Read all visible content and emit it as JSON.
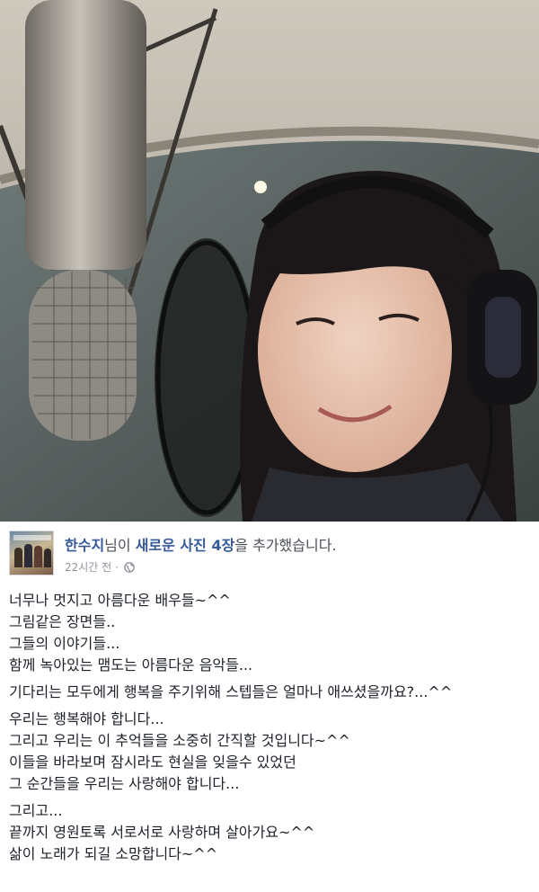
{
  "post": {
    "author_name": "한수지",
    "headline_mid": "님이 ",
    "headline_link": "새로운 사진 4장",
    "headline_end": "을 추가했습니다.",
    "timestamp": "22시간 전",
    "separator": " · ",
    "privacy_icon": "globe-icon",
    "paragraphs": [
      [
        "너무나 멋지고 아름다운 배우들~^^",
        "그림같은 장면들..",
        "그들의 이야기들...",
        "함께 녹아있는 맴도는 아름다운 음악들..."
      ],
      [
        "기다리는 모두에게 행복을 주기위해 스텝들은 얼마나 애쓰셨을까요?...^^"
      ],
      [
        "우리는 행복해야 합니다...",
        "그리고 우리는 이 추억들을 소중히 간직할 것입니다~^^",
        "이들을 바라보며 잠시라도 현실을 잊을수 있었던",
        "그 순간들을 우리는 사랑해야 합니다..."
      ],
      [
        "그리고...",
        "끝까지 영원토록 서로서로 사랑하며 살아가요~^^",
        "삶이 노래가 되길 소망합니다~^^"
      ]
    ]
  },
  "colors": {
    "link": "#365899",
    "meta": "#90949c",
    "text": "#1d2129"
  }
}
